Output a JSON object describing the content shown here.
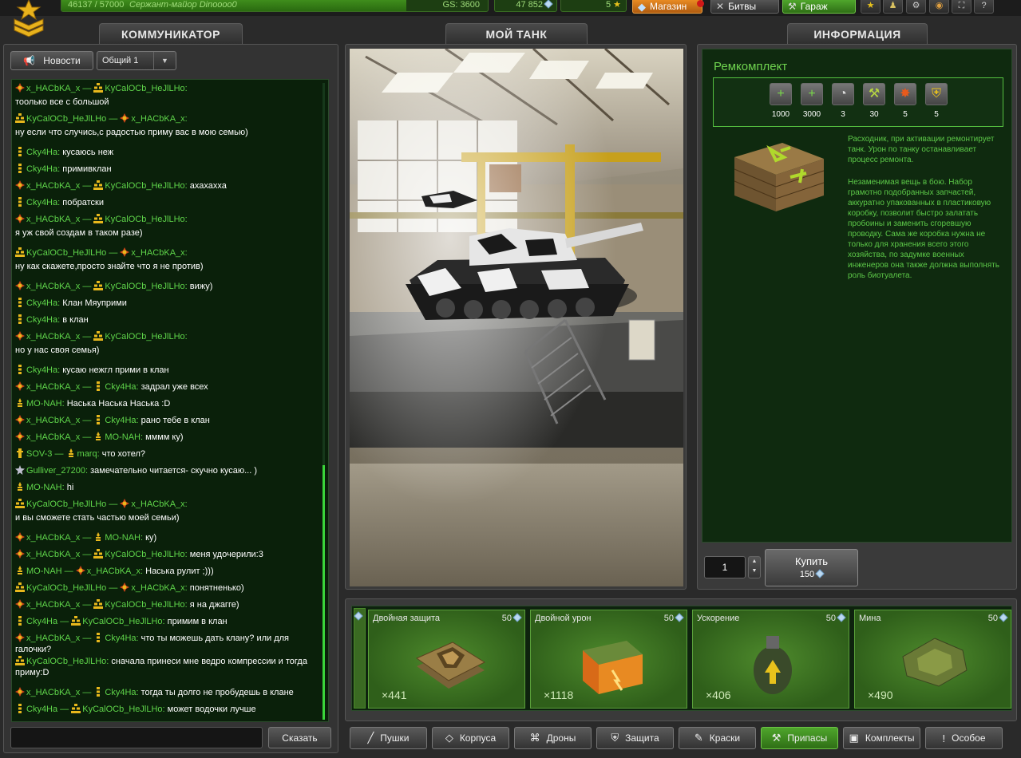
{
  "topbar": {
    "xp": "46137 / 57000",
    "rank": "Сержант-майор Dinoooo0",
    "gs": "GS: 3600",
    "xp_fraction": 0.809,
    "crystals": "47 852",
    "stars": "5",
    "shop_label": "Магазин",
    "battles_label": "Битвы",
    "garage_label": "Гараж"
  },
  "panels": {
    "left_title": "КОММУНИКАТОР",
    "center_title": "МОЙ ТАНК",
    "right_title": "ИНФОРМАЦИЯ"
  },
  "chat": {
    "news_label": "Новости",
    "channel": "Общий 1",
    "send_label": "Сказать",
    "scroll_thumb_start": 0.6,
    "scroll_thumb_length": 0.4,
    "messages": [
      {
        "from": "x_HACbKA_x",
        "to": "KyCalOCb_HeJlLHo",
        "text": "",
        "nl": ""
      },
      {
        "from": "",
        "to": "",
        "text": "тоолько все с большой"
      },
      {
        "from": "KyCalOCb_HeJlLHo",
        "to": "x_HACbKA_x",
        "text": ""
      },
      {
        "from": "",
        "to": "",
        "text": "ну если что случись,с радостью приму вас в мою семью)"
      },
      {
        "from": "Cky4Ha",
        "to": "",
        "text": "кусаюсь неж"
      },
      {
        "from": "Cky4Ha",
        "to": "",
        "text": "примивклан"
      },
      {
        "from": "x_HACbKA_x",
        "to": "KyCalOCb_HeJlLHo",
        "text": "ахахахха"
      },
      {
        "from": "Cky4Ha",
        "to": "",
        "text": "побратски"
      },
      {
        "from": "x_HACbKA_x",
        "to": "KyCalOCb_HeJlLHo",
        "text": ""
      },
      {
        "from": "",
        "to": "",
        "text": "я уж свой создам в таком разе)"
      },
      {
        "from": "KyCalOCb_HeJlLHo",
        "to": "x_HACbKA_x",
        "text": ""
      },
      {
        "from": "",
        "to": "",
        "text": "ну как скажете,просто знайте что я не против)"
      },
      {
        "from": "x_HACbKA_x",
        "to": "KyCalOCb_HeJlLHo",
        "text": "вижу)"
      },
      {
        "from": "Cky4Ha",
        "to": "",
        "text": "Клан Мяуприми"
      },
      {
        "from": "Cky4Ha",
        "to": "",
        "text": "в клан"
      },
      {
        "from": "x_HACbKA_x",
        "to": "KyCalOCb_HeJlLHo",
        "text": ""
      },
      {
        "from": "",
        "to": "",
        "text": "но у нас своя семья)"
      },
      {
        "from": "Cky4Ha",
        "to": "",
        "text": "кусаю нежгл прими в клан"
      },
      {
        "from": "x_HACbKA_x",
        "to": "Cky4Ha",
        "text": "задрал уже всех"
      },
      {
        "from": "MO-NAH",
        "to": "",
        "text": "Наська Наська Наська :D"
      },
      {
        "from": "x_HACbKA_x",
        "to": "Cky4Ha",
        "text": "рано тебе в клан"
      },
      {
        "from": "x_HACbKA_x",
        "to": "MO-NAH",
        "text": "мммм ку)"
      },
      {
        "from": "SOV-3",
        "to": "marq",
        "text": "что хотел?"
      },
      {
        "from": "Gulliver_27200",
        "to": "",
        "text": "замечательно читается- скучно кусаю... )"
      },
      {
        "from": "MO-NAH",
        "to": "",
        "text": "hi"
      },
      {
        "from": "KyCalOCb_HeJlLHo",
        "to": "x_HACbKA_x",
        "text": ""
      },
      {
        "from": "",
        "to": "",
        "text": "и вы сможете стать частью моей семьи)"
      },
      {
        "from": "x_HACbKA_x",
        "to": "MO-NAH",
        "text": "ку)"
      },
      {
        "from": "x_HACbKA_x",
        "to": "KyCalOCb_HeJlLHo",
        "text": "меня удочерили:3"
      },
      {
        "from": "MO-NAH",
        "to": "x_HACbKA_x",
        "text": "Наська рулит ;)))"
      },
      {
        "from": "KyCalOCb_HeJlLHo",
        "to": "x_HACbKA_x",
        "text": "понятненько)"
      },
      {
        "from": "x_HACbKA_x",
        "to": "KyCalOCb_HeJlLHo",
        "text": "я на джагге)"
      },
      {
        "from": "Cky4Ha",
        "to": "KyCalOCb_HeJlLHo",
        "text": "примим в клан"
      },
      {
        "from": "x_HACbKA_x",
        "to": "Cky4Ha",
        "text": "что ты можешь дать клану? или для галочки?"
      },
      {
        "from": "KyCalOCb_HeJlLHo",
        "to": "",
        "text": "сначала принеси мне ведро компрессии и тогда приму:D"
      },
      {
        "from": "x_HACbKA_x",
        "to": "Cky4Ha",
        "text": "тогда ты долго не пробудешь в клане"
      },
      {
        "from": "Cky4Ha",
        "to": "KyCalOCb_HeJlLHo",
        "text": "может водочки лучше"
      }
    ]
  },
  "info": {
    "title": "Ремкомплект",
    "props": [
      {
        "icon": "health-icon",
        "value": "1000"
      },
      {
        "icon": "health-regen-icon",
        "value": "3000"
      },
      {
        "icon": "timer-icon",
        "value": "3"
      },
      {
        "icon": "wrench-timer-icon",
        "value": "30"
      },
      {
        "icon": "burn-timer-icon",
        "value": "5"
      },
      {
        "icon": "shield-timer-icon",
        "value": "5"
      }
    ],
    "desc1": "Расходник, при активации ремонтирует танк. Урон по танку останавливает процесс ремонта.",
    "desc2": "Незаменимая вещь в бою. Набор грамотно подобранных запчастей, аккуратно упакованных в пластиковую коробку, позволит быстро залатать пробоины и заменить сгоревшую проводку. Сама же коробка нужна не только для хранения всего этого хозяйства, по задумке военных инженеров она также должна выполнять роль биотуалета.",
    "quantity": "1",
    "buy_label": "Купить",
    "buy_price": "150"
  },
  "items": [
    {
      "name": "Двойная защита",
      "price": "50",
      "count": "×441",
      "icon": "double-armor-icon"
    },
    {
      "name": "Двойной урон",
      "price": "50",
      "count": "×1118",
      "icon": "double-damage-icon"
    },
    {
      "name": "Ускорение",
      "price": "50",
      "count": "×406",
      "icon": "nitro-icon"
    },
    {
      "name": "Мина",
      "price": "50",
      "count": "×490",
      "icon": "mine-icon"
    }
  ],
  "categories": [
    {
      "label": "Пушки",
      "icon": "gun-icon",
      "active": false
    },
    {
      "label": "Корпуса",
      "icon": "hull-icon",
      "active": false
    },
    {
      "label": "Дроны",
      "icon": "drone-icon",
      "active": false
    },
    {
      "label": "Защита",
      "icon": "shield-icon",
      "active": false
    },
    {
      "label": "Краски",
      "icon": "paint-icon",
      "active": false
    },
    {
      "label": "Припасы",
      "icon": "supplies-icon",
      "active": true
    },
    {
      "label": "Комплекты",
      "icon": "kits-icon",
      "active": false
    },
    {
      "label": "Особое",
      "icon": "special-icon",
      "active": false
    }
  ],
  "colors": {
    "accent_green": "#5fd54a",
    "shop_orange": "#d07a1a",
    "garage_green": "#3e8d1e"
  }
}
